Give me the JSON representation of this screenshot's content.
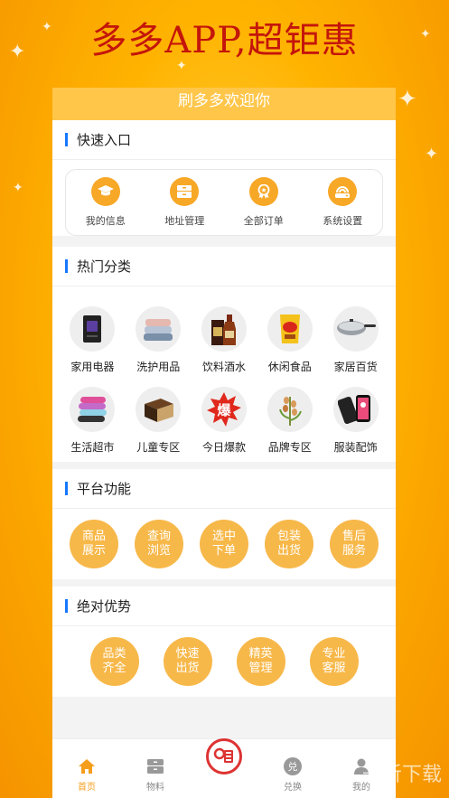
{
  "banner": {
    "title": "多多APP,超钜惠"
  },
  "welcome": "刷多多欢迎你",
  "quick": {
    "title": "快速入口",
    "items": [
      {
        "label": "我的信息",
        "icon": "graduation-cap-icon"
      },
      {
        "label": "地址管理",
        "icon": "folder-icon"
      },
      {
        "label": "全部订单",
        "icon": "medal-icon"
      },
      {
        "label": "系统设置",
        "icon": "settings-icon"
      }
    ]
  },
  "categories": {
    "title": "热门分类",
    "items": [
      {
        "label": "家用电器",
        "icon": "appliance-image"
      },
      {
        "label": "洗护用品",
        "icon": "towel-image"
      },
      {
        "label": "饮料酒水",
        "icon": "liquor-image"
      },
      {
        "label": "休闲食品",
        "icon": "snack-image"
      },
      {
        "label": "家居百货",
        "icon": "wok-image"
      },
      {
        "label": "生活超市",
        "icon": "yoga-mat-image"
      },
      {
        "label": "儿童专区",
        "icon": "box-image"
      },
      {
        "label": "今日爆款",
        "icon": "burst-badge-image"
      },
      {
        "label": "品牌专区",
        "icon": "plant-image"
      },
      {
        "label": "服装配饰",
        "icon": "phone-image"
      }
    ],
    "burst_text": "爆"
  },
  "platform": {
    "title": "平台功能",
    "items": [
      "商品展示",
      "查询浏览",
      "选中下单",
      "包装出货",
      "售后服务"
    ]
  },
  "advantage": {
    "title": "绝对优势",
    "items": [
      "品类齐全",
      "快速出货",
      "精英管理",
      "专业客服"
    ]
  },
  "tabbar": {
    "items": [
      {
        "label": "首页",
        "icon": "home-icon",
        "active": true
      },
      {
        "label": "物料",
        "icon": "box-icon",
        "active": false
      },
      {
        "label": "",
        "icon": "center-logo-icon",
        "active": false
      },
      {
        "label": "兑换",
        "icon": "exchange-icon",
        "active": false
      },
      {
        "label": "我的",
        "icon": "user-icon",
        "active": false
      }
    ],
    "exchange_glyph": "兑"
  },
  "watermark": "一听下载",
  "colors": {
    "accent": "#f7a827",
    "banner_text": "#c4150b",
    "section_bar": "#1677ff",
    "active_tab": "#f59e1b"
  }
}
